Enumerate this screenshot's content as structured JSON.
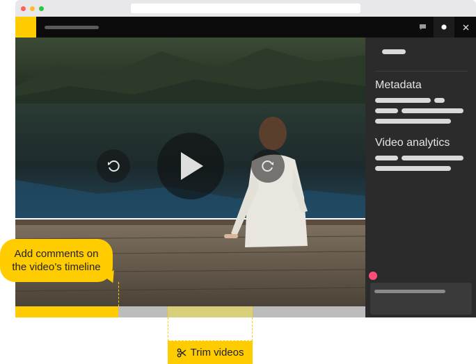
{
  "colors": {
    "accent": "#ffcc00",
    "app_bar": "#0c0c0c",
    "panel": "#2b2b2b",
    "timeline": "#bcbcbc",
    "trim_segment": "#d8cf7a",
    "record_dot": "#ff4d7a",
    "window_dots": [
      "#ff5f57",
      "#ffbd2e",
      "#28c840"
    ]
  },
  "titlebar_icons": [
    "comment-icon",
    "record-icon",
    "close-icon"
  ],
  "video_controls": {
    "rewind_icon": "rewind-icon",
    "play_icon": "play-icon",
    "forward_icon": "forward-icon"
  },
  "panel": {
    "metadata_title": "Metadata",
    "analytics_title": "Video analytics"
  },
  "callouts": {
    "comments_line1": "Add comments on",
    "comments_line2": "the video’s timeline",
    "trim_label": "Trim videos",
    "trim_icon": "scissors-icon"
  }
}
